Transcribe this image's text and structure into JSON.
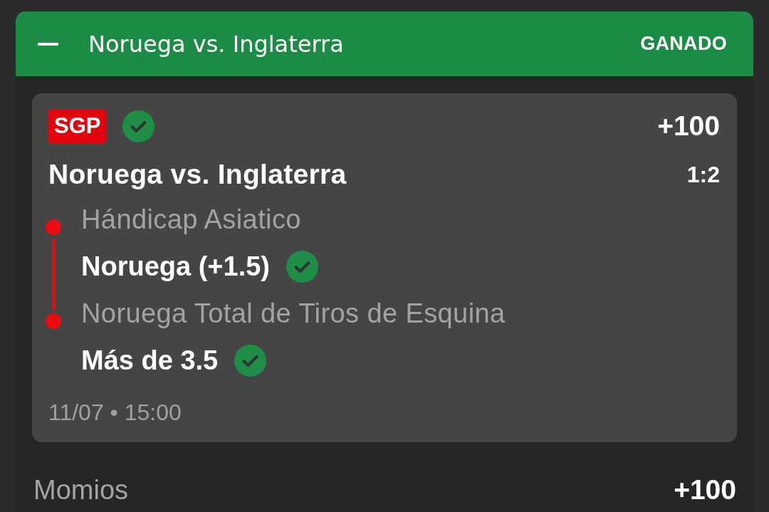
{
  "header": {
    "expanded": true,
    "title": "Noruega vs. Inglaterra",
    "status": "GANADO"
  },
  "card": {
    "badge": "SGP",
    "won": true,
    "odds": "+100",
    "match": "Noruega vs. Inglaterra",
    "score": "1:2",
    "legs": [
      {
        "market": "Hándicap Asiatico",
        "selection": "Noruega (+1.5)",
        "won": true
      },
      {
        "market": "Noruega Total de Tiros de Esquina",
        "selection": "Más de 3.5",
        "won": true
      }
    ],
    "datetime": "11/07 • 15:00"
  },
  "summary": {
    "label": "Momios",
    "value": "+100"
  }
}
